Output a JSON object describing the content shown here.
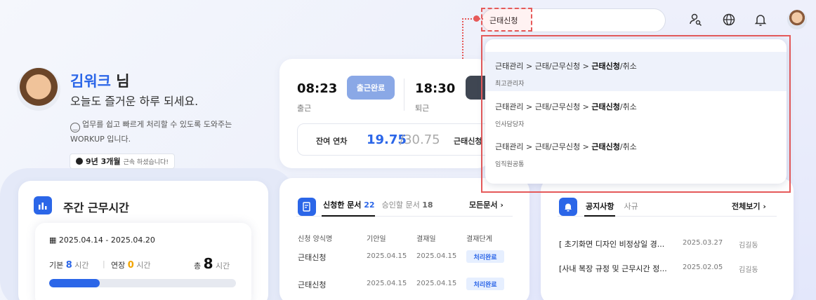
{
  "header": {
    "search_value": "근태신청"
  },
  "profile": {
    "name": "김워크",
    "suffix": "님",
    "greeting": "오늘도 즐거운 하루 되세요.",
    "description_line1": "업무를 쉽고 빠르게 처리할 수 있도록 도와주는",
    "description_line2": "WORKUP 입니다.",
    "tenure_bold": "9년 3개월",
    "tenure_suffix": "근속 하셨습니다!"
  },
  "attendance": {
    "checkin_time": "08:23",
    "checkin_label": "출근",
    "checkin_button": "출근완료",
    "checkout_time": "18:30",
    "checkout_label": "퇴근",
    "leave_label": "잔여 연차",
    "leave_remaining": "19.75",
    "leave_total": "/30.75",
    "leave_action": "근태신청"
  },
  "weekly": {
    "title": "주간 근무시간",
    "range": "2025.04.14 - 2025.04.20",
    "base_label": "기본",
    "base_value": "8",
    "overtime_label": "연장",
    "overtime_value": "0",
    "unit": "시간",
    "total_label": "총",
    "total_value": "8",
    "progress_fraction": 0.27
  },
  "documents": {
    "tab_requested": "신청한 문서",
    "tab_requested_count": "22",
    "tab_approved": "승인할 문서",
    "tab_approved_count": "18",
    "all_link": "모든문서",
    "columns": [
      "신청 양식명",
      "기안일",
      "결재일",
      "결재단계"
    ],
    "rows": [
      {
        "form": "근태신청",
        "drafted": "2025.04.15",
        "approved": "2025.04.15",
        "status": "처리완료"
      },
      {
        "form": "근태신청",
        "drafted": "2025.04.15",
        "approved": "2025.04.15",
        "status": "처리완료"
      }
    ]
  },
  "notices": {
    "tab_notice": "공지사항",
    "tab_company": "사규",
    "all_link": "전체보기",
    "rows": [
      {
        "title": "[ 초기화면 디자인 비정상일 경...",
        "date": "2025.03.27",
        "author": "김길동"
      },
      {
        "title": "[사내 복장 규정 및 근무시간 정...",
        "date": "2025.02.05",
        "author": "김길동"
      }
    ]
  },
  "search_results": [
    {
      "path_prefix": "근태관리 > 근태/근무신청 > ",
      "path_bold": "근태신청",
      "path_suffix": "/취소",
      "scope": "최고관리자"
    },
    {
      "path_prefix": "근태관리 > 근태/근무신청 > ",
      "path_bold": "근태신청",
      "path_suffix": "/취소",
      "scope": "인사담당자"
    },
    {
      "path_prefix": "근태관리 > 근태/근무신청 > ",
      "path_bold": "근태신청",
      "path_suffix": "/취소",
      "scope": "임직원공통"
    }
  ],
  "colors": {
    "accent": "#2b66e8",
    "highlight": "#e65a5a",
    "overtime": "#f2a400"
  }
}
